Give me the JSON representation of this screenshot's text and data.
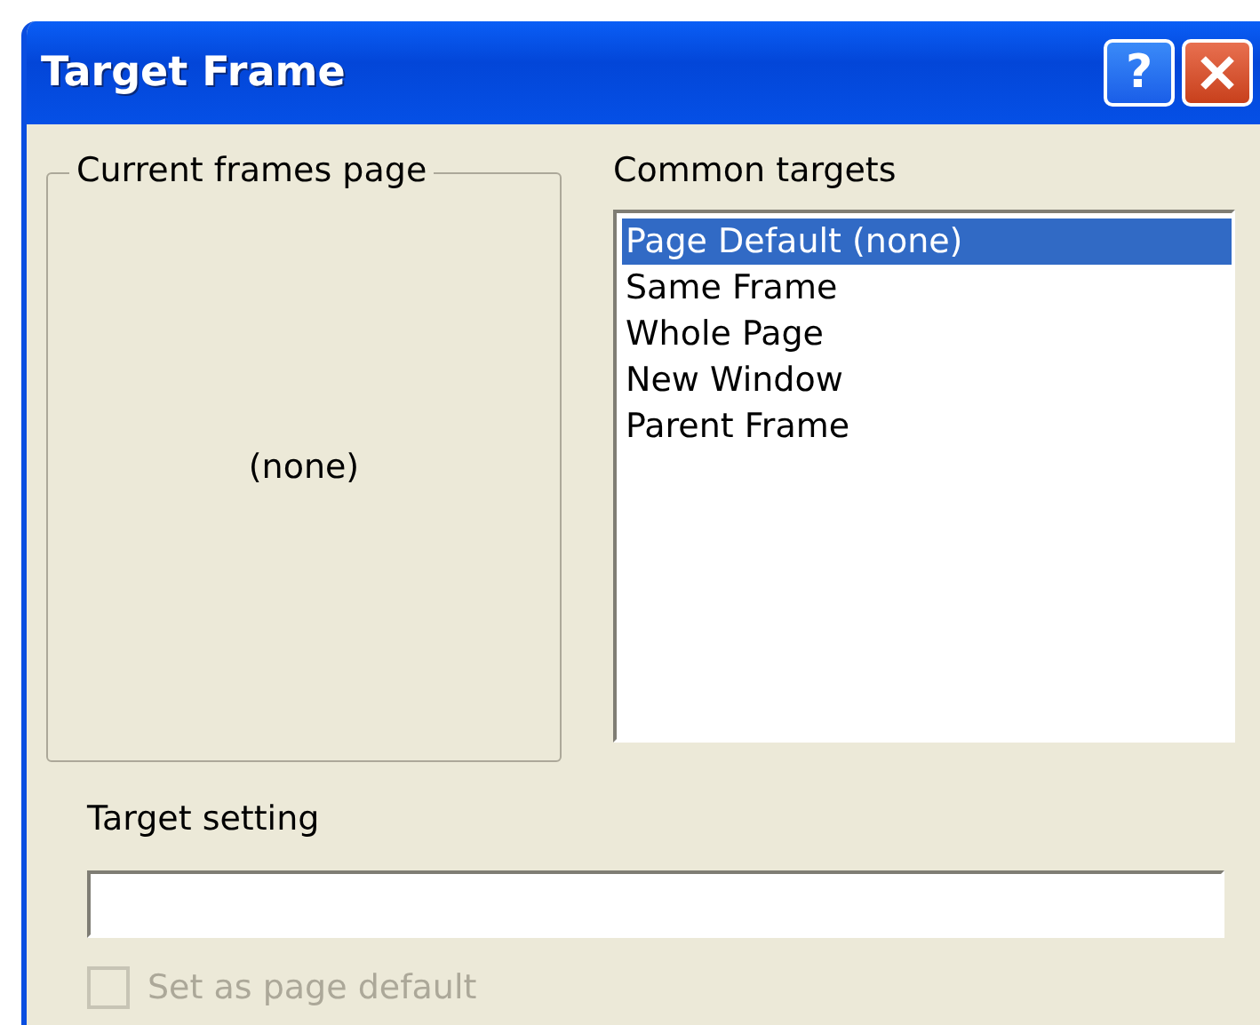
{
  "window": {
    "title": "Target Frame",
    "buttons": [
      {
        "kind": "help",
        "label": "?"
      },
      {
        "kind": "close"
      }
    ]
  },
  "current_frames_page": {
    "title": "Current frames page",
    "content": "(none)"
  },
  "common_targets": {
    "label": "Common targets",
    "items": [
      {
        "label": "Page Default (none)",
        "selected": true
      },
      {
        "label": "Same Frame",
        "selected": false
      },
      {
        "label": "Whole Page",
        "selected": false
      },
      {
        "label": "New Window",
        "selected": false
      },
      {
        "label": "Parent Frame",
        "selected": false
      }
    ]
  },
  "target_setting": {
    "label": "Target setting"
  },
  "set_as_page_default": {
    "label": "Set as page default",
    "checked": false,
    "disabled": true
  }
}
